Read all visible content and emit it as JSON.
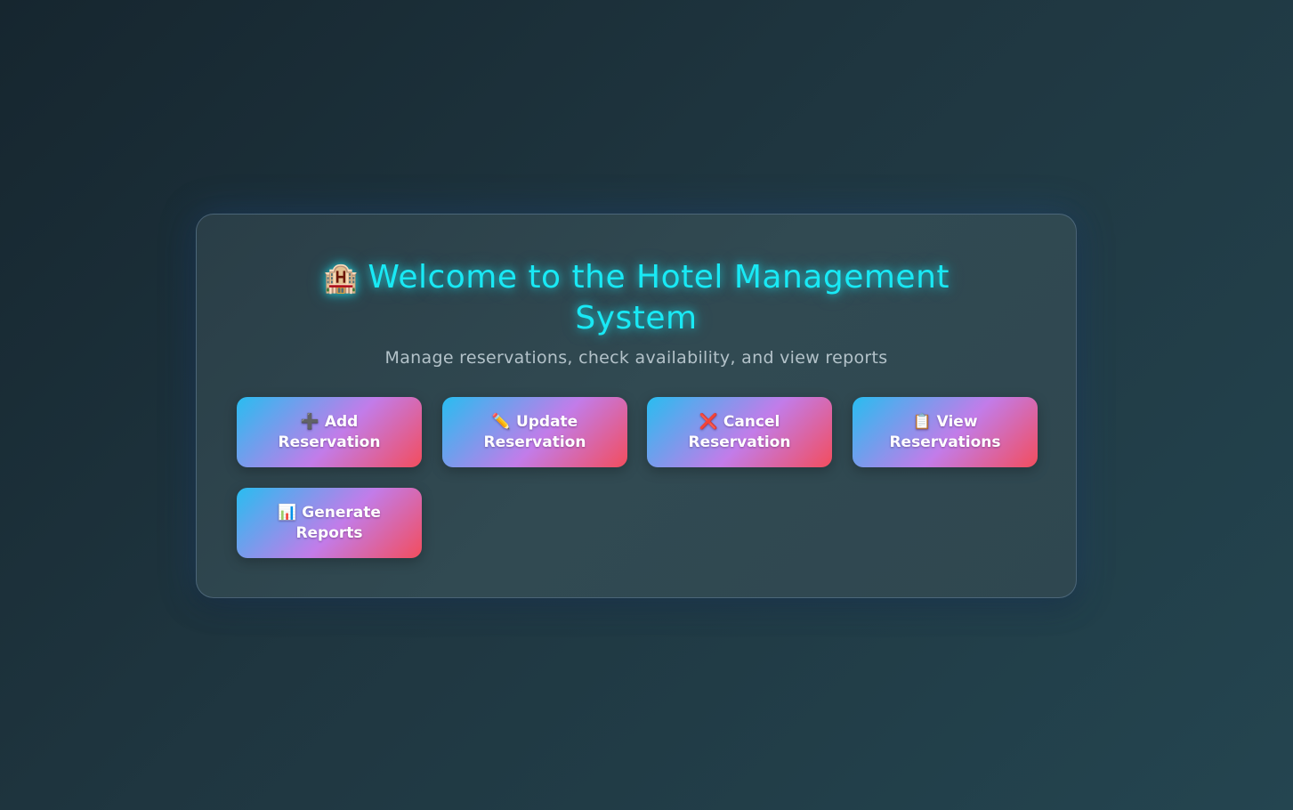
{
  "header": {
    "icon": "hotel-icon",
    "icon_glyph": "🏨",
    "title": "Welcome to the Hotel Management System",
    "subtitle": "Manage reservations, check availability, and view reports"
  },
  "actions": [
    {
      "id": "add",
      "icon": "plus-icon",
      "glyph": "➕",
      "label": "Add Reservation"
    },
    {
      "id": "update",
      "icon": "pencil-icon",
      "glyph": "✏️",
      "label": "Update Reservation"
    },
    {
      "id": "cancel",
      "icon": "cross-icon",
      "glyph": "❌",
      "label": "Cancel Reservation"
    },
    {
      "id": "view",
      "icon": "clipboard-icon",
      "glyph": "📋",
      "label": "View Reservations"
    },
    {
      "id": "reports",
      "icon": "bar-chart-icon",
      "glyph": "📊",
      "label": "Generate Reports"
    }
  ],
  "colors": {
    "title": "#19e9f5",
    "subtitle": "#b3c2c9",
    "button_gradient": [
      "#28bdf0",
      "#c27ce9",
      "#f34d5d"
    ]
  }
}
